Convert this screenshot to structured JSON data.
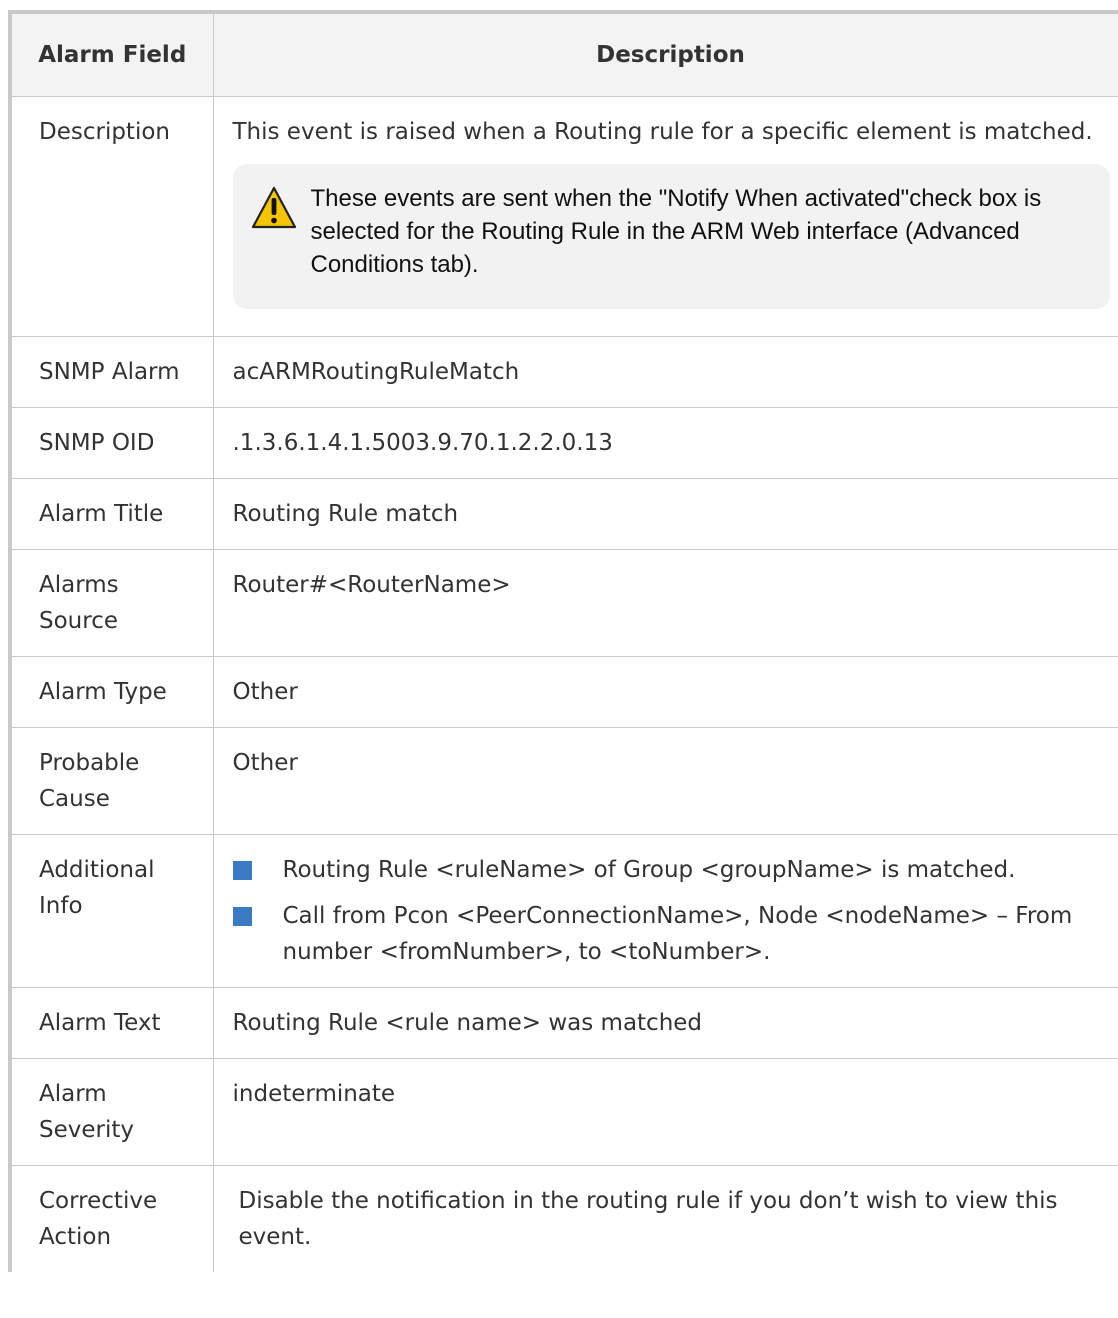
{
  "table": {
    "headers": [
      "Alarm Field",
      "Description"
    ],
    "description": {
      "field": "Description",
      "text": "This event is raised when a Routing rule for a specific element is matched.",
      "note": {
        "icon": "warning-icon",
        "text": "These events are sent when the \"Notify When activated\"check box is selected for the Routing Rule in the ARM Web interface (Advanced Conditions tab)."
      }
    },
    "snmp_alarm": {
      "field": "SNMP Alarm",
      "value": "acARMRoutingRuleMatch"
    },
    "snmp_oid": {
      "field": "SNMP OID",
      "value": ".1.3.6.1.4.1.5003.9.70.1.2.2.0.13"
    },
    "alarm_title": {
      "field": "Alarm Title",
      "value": "Routing Rule match"
    },
    "alarms_source": {
      "field": "Alarms Source",
      "value": "Router#<RouterName>"
    },
    "alarm_type": {
      "field": "Alarm Type",
      "value": "Other"
    },
    "probable_cause": {
      "field": "Probable Cause",
      "value": "Other"
    },
    "additional_info": {
      "field": "Additional Info",
      "items": [
        "Routing Rule <ruleName> of Group <groupName> is matched.",
        "Call from Pcon <PeerConnectionName>, Node <nodeName> – From number <fromNumber>, to <toNumber>."
      ]
    },
    "alarm_text": {
      "field": "Alarm Text",
      "value": "Routing Rule <rule name> was matched"
    },
    "alarm_severity": {
      "field": "Alarm Severity",
      "value": "indeterminate"
    },
    "corrective_action": {
      "field": "Corrective Action",
      "value": "Disable the notification in the routing rule if you don’t wish to view this event."
    }
  },
  "colors": {
    "border": "#c9c9c9",
    "header_bg": "#f3f3f3",
    "note_bg": "#f2f2f2",
    "bullet": "#3a7ac4",
    "warning_fill": "#f5c400"
  }
}
